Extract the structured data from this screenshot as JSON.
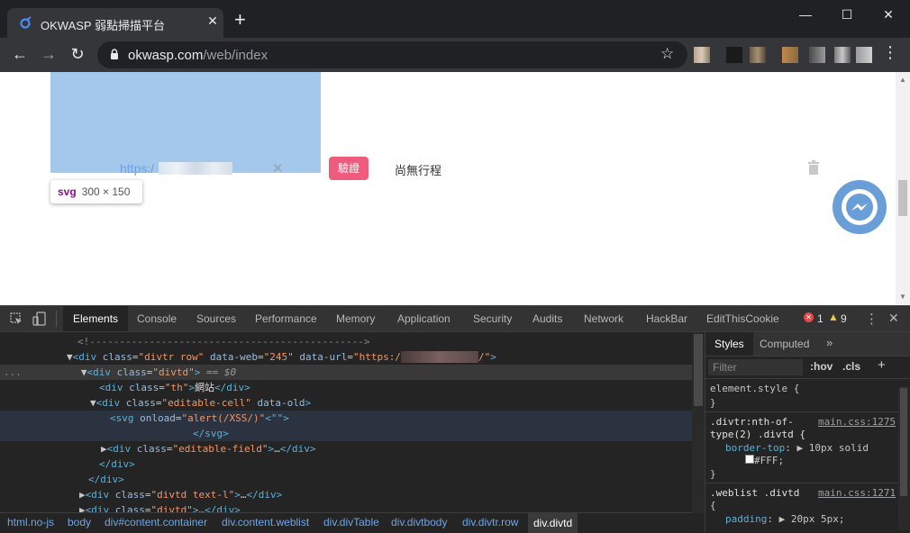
{
  "browser": {
    "tab_title": "OKWASP 弱點掃描平台",
    "url_host": "okwasp.com",
    "url_path": "/web/index"
  },
  "page": {
    "url_cell_text": "https:/",
    "verify_button": "驗證",
    "status_text": "尚無行程",
    "tooltip_tag": "svg",
    "tooltip_size": "300 × 150"
  },
  "devtools": {
    "tabs": [
      "Elements",
      "Console",
      "Sources",
      "Performance",
      "Memory",
      "Application",
      "Security",
      "Audits",
      "Network",
      "HackBar",
      "EditThisCookie"
    ],
    "error_count": "1",
    "warning_count": "9",
    "styles_tabs": [
      "Styles",
      "Computed"
    ],
    "filter_placeholder": "Filter",
    "hov": ":hov",
    "cls": ".cls",
    "breadcrumbs": [
      "html.no-js",
      "body",
      "div#content.container",
      "div.content.weblist",
      "div.divTable",
      "div.divtbody",
      "div.divtr.row",
      "div.divtd"
    ],
    "styles": {
      "element_style": "element.style {",
      "rule1_selector": ".divtr:nth-of-",
      "rule1_selector2": "type(2) .divtd {",
      "rule1_source": "main.css:1275",
      "rule1_prop": "border-top",
      "rule1_value": "10px solid",
      "rule1_color": "#FFF;",
      "rule2_selector": ".weblist .divtd",
      "rule2_source": "main.css:1271",
      "rule2_prop": "padding",
      "rule2_value": "20px 5px;"
    },
    "dom_lines": {
      "comment": "<!---------------------------------------------->",
      "data_web": "\"245\"",
      "dollar": "== $0",
      "th_text": "網站",
      "onload": "\"alert(/XSS/)\"",
      "quote": "<\"\">"
    }
  },
  "colors": {
    "accent_pink": "#ef5b7c",
    "svg_highlight": "#a4c8ec",
    "messenger_blue": "#6a9ed8"
  }
}
